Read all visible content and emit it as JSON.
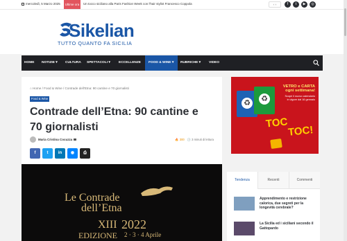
{
  "topbar": {
    "date": "mercoledì, 5 Marzo 2025",
    "breaking_label": "Ultime ora",
    "ticker": "Un tocco siciliano alla Paris Fashion Week con l'hair stylist Francesco Coppola",
    "arrows": "‹ ›",
    "social": [
      {
        "icon": "facebook-icon",
        "glyph": "f"
      },
      {
        "icon": "twitter-icon",
        "glyph": "t"
      },
      {
        "icon": "youtube-icon",
        "glyph": "▶"
      },
      {
        "icon": "instagram-icon",
        "glyph": "◎"
      }
    ]
  },
  "header": {
    "logo_name": "Sikelian",
    "tagline": "TUTTO QUANTO FA SICILIA"
  },
  "nav": {
    "items": [
      {
        "label": "HOME",
        "active": false
      },
      {
        "label": "NOTIZIE ▾",
        "active": false
      },
      {
        "label": "CULTURA",
        "active": false
      },
      {
        "label": "SPETTACOLI ▾",
        "active": false
      },
      {
        "label": "ECCELLENZE",
        "active": false
      },
      {
        "label": "FOOD & WINE ▾",
        "active": true
      },
      {
        "label": "RUBRICHE ▾",
        "active": false
      },
      {
        "label": "VIDEO",
        "active": false
      }
    ]
  },
  "article": {
    "breadcrumb": "⌂ Home / Food & Wine / Contrade dell'Etna: 90 cantine e 70 giornalisti",
    "category": "Food & Wine",
    "title": "Contrade dell’Etna: 90 cantine e 70 giornalisti",
    "author": "Maria Cristina Cocuzza",
    "views": "🔥 300",
    "read_time": "🕓 3 minuti di lettura",
    "share_buttons": [
      {
        "icon": "facebook-icon",
        "glyph": "f",
        "color": "#4267b2"
      },
      {
        "icon": "twitter-icon",
        "glyph": "t",
        "color": "#1da1f2"
      },
      {
        "icon": "linkedin-icon",
        "glyph": "in",
        "color": "#0077b5"
      },
      {
        "icon": "messenger-icon",
        "glyph": "◉",
        "color": "#0084ff"
      },
      {
        "icon": "print-icon",
        "glyph": "⎙",
        "color": "#222222"
      }
    ],
    "hero": {
      "line1": "Le Contrade",
      "line2": "dell’Etna",
      "edition_num": "XIII",
      "year": "2022",
      "edition_label": "EDIZIONE",
      "dates": "2 · 3 · 4 Aprile"
    }
  },
  "ad": {
    "headline1": "VETRO e CARTA",
    "headline2": "ogni settimana!",
    "sub1": "Scopri il nuovo calendario",
    "sub2": "in vigore dal 16 gennaio",
    "toc1": "TOC",
    "toc2": "TOC!"
  },
  "widget": {
    "tabs": [
      {
        "label": "Tendenza",
        "active": true
      },
      {
        "label": "Recenti",
        "active": false
      },
      {
        "label": "Commenti",
        "active": false
      }
    ],
    "posts": [
      {
        "title": "Apprendimento e restrizione calorica, due segreti per la longevità cerebrale?"
      },
      {
        "title": "La Sicilia ed i siciliani secondo il Gattopardo"
      }
    ]
  },
  "colors": {
    "brand": "#1a56a6",
    "nav_bg": "#1f2024",
    "breaking": "#e2555e",
    "ad_red": "#c9141c"
  }
}
